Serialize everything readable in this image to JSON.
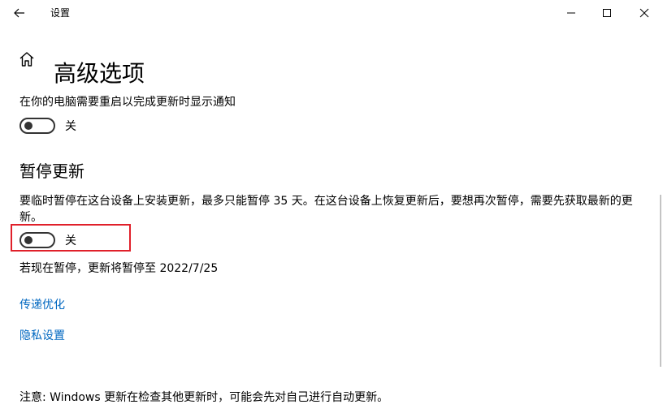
{
  "window": {
    "title": "设置",
    "icons": {
      "back": "back-arrow-icon",
      "minimize": "minimize-icon",
      "maximize": "maximize-icon",
      "close": "close-icon",
      "home": "home-icon"
    }
  },
  "page": {
    "title": "高级选项"
  },
  "restart_notify": {
    "label": "在你的电脑需要重启以完成更新时显示通知",
    "toggle_state": "关",
    "is_on": false
  },
  "pause_updates": {
    "section_title": "暂停更新",
    "description": "要临时暂停在这台设备上安装更新，最多只能暂停 35 天。在这台设备上恢复更新后，要想再次暂停，需要先获取最新的更新。",
    "toggle_state": "关",
    "is_on": false,
    "pause_info": "若现在暂停，更新将暂停至 2022/7/25"
  },
  "links": {
    "delivery_optimization": "传递优化",
    "privacy_settings": "隐私设置"
  },
  "note": "注意: Windows 更新在检查其他更新时，可能会先对自己进行自动更新。",
  "colors": {
    "link": "#0067c0",
    "highlight": "#e0202a",
    "toggle_off": "#333333"
  }
}
